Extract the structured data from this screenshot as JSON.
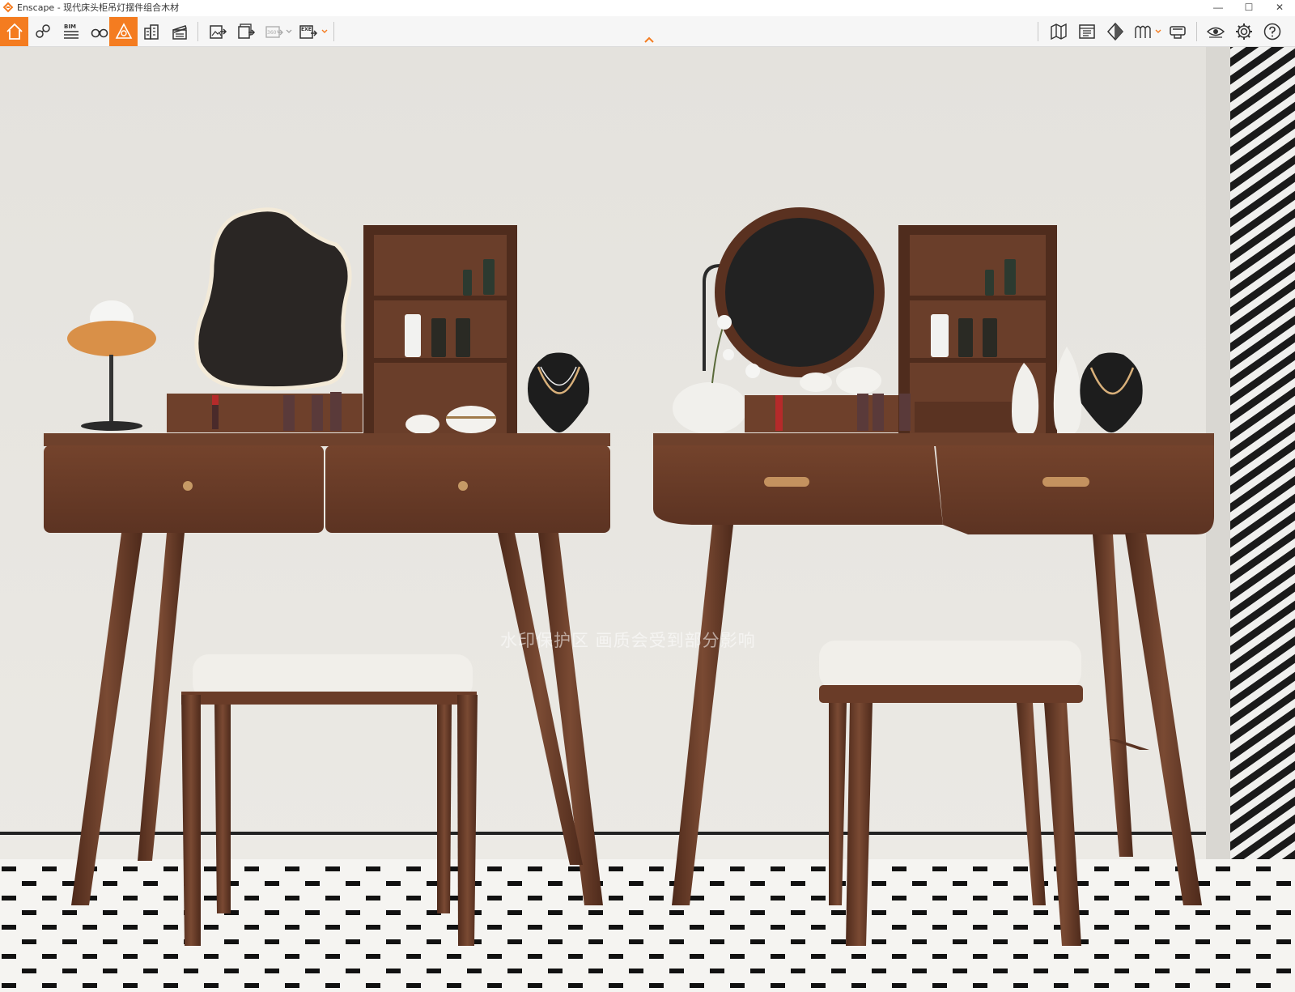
{
  "window": {
    "title": "Enscape - 现代床头柜吊灯摆件组合木材",
    "controls": {
      "minimize": "—",
      "maximize": "☐",
      "close": "✕"
    }
  },
  "toolbar": {
    "left_tools": [
      {
        "id": "home",
        "icon": "home-icon",
        "active": true
      },
      {
        "id": "views",
        "icon": "map-pin-icon",
        "active": false
      },
      {
        "id": "bim",
        "icon": "bim-icon",
        "label": "BIM",
        "active": false
      },
      {
        "id": "walk",
        "icon": "binoculars-icon",
        "active": false
      },
      {
        "id": "assets",
        "icon": "asset-library-icon",
        "active": true
      },
      {
        "id": "buildings",
        "icon": "building-icon",
        "active": false
      },
      {
        "id": "video",
        "icon": "clapperboard-icon",
        "active": false
      }
    ],
    "export_tools": [
      {
        "id": "screenshot",
        "icon": "export-image-icon"
      },
      {
        "id": "batch",
        "icon": "batch-render-icon"
      },
      {
        "id": "pano",
        "icon": "panorama-360-icon",
        "label": "360°"
      },
      {
        "id": "exe",
        "icon": "export-exe-icon",
        "label": "EXE"
      }
    ],
    "right_tools": [
      {
        "id": "map",
        "icon": "map-icon"
      },
      {
        "id": "minimap",
        "icon": "minimap-icon"
      },
      {
        "id": "sections",
        "icon": "section-box-icon"
      },
      {
        "id": "atmosphere",
        "icon": "atmosphere-icon"
      },
      {
        "id": "capture",
        "icon": "capture-icon"
      },
      {
        "id": "visibility",
        "icon": "eye-icon"
      },
      {
        "id": "settings",
        "icon": "gear-icon"
      },
      {
        "id": "help",
        "icon": "help-icon"
      }
    ],
    "accent_color": "#f47c20"
  },
  "viewport": {
    "watermark": "水印保护区  画质会受到部分影响",
    "wall_color": "#e8e6e1",
    "wood_color": "#6b3f2a"
  }
}
